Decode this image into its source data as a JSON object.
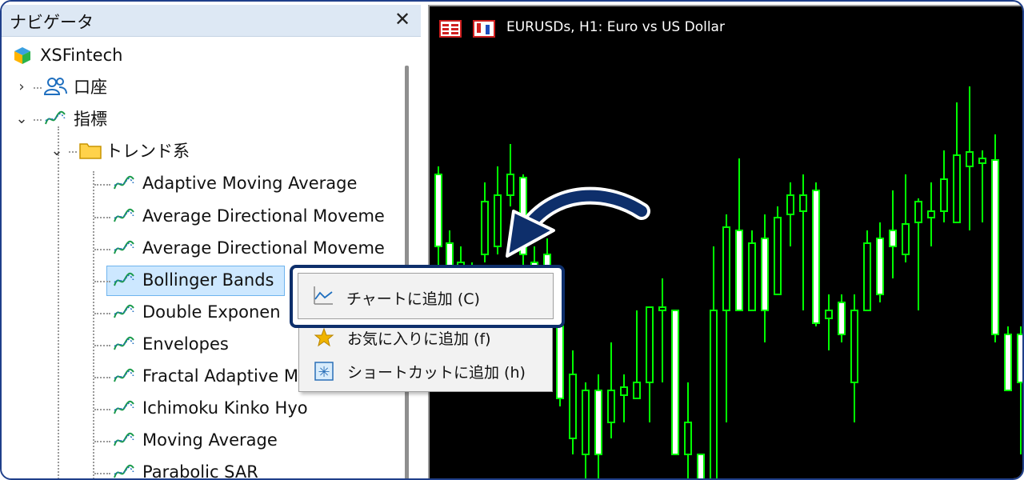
{
  "navigator": {
    "title": "ナビゲータ",
    "close_glyph": "✕",
    "root": "XSFintech",
    "account": "口座",
    "indicators": "指標",
    "folder": "トレンド系",
    "items": [
      "Adaptive Moving Average",
      "Average Directional Moveme",
      "Average Directional Moveme",
      "Bollinger Bands",
      "Double Exponen",
      "Envelopes",
      "Fractal Adaptive M",
      "Ichimoku Kinko Hyo",
      "Moving Average",
      "Parabolic SAR"
    ],
    "selected_item": "Bollinger Bands"
  },
  "chart": {
    "title": "EURUSDs, H1:  Euro vs US Dollar",
    "background": "#000000",
    "candle_color": "#00ff00",
    "bull_fill": "#000000",
    "bear_fill": "#ffffff"
  },
  "context_menu": {
    "items": [
      {
        "label": "チャートに追加 (C)",
        "icon": "chart-line-icon"
      },
      {
        "label": "お気に入りに追加 (f)",
        "icon": "star-icon"
      },
      {
        "label": "ショートカットに追加 (h)",
        "icon": "shortcut-icon"
      }
    ]
  },
  "colors": {
    "panel_header": "#dde8f4",
    "selection": "#cde8ff",
    "highlight_border": "#0e2f6b",
    "arrow": "#0e2f6b"
  }
}
